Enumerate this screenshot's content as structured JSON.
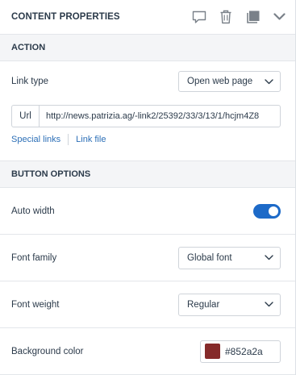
{
  "header": {
    "title": "CONTENT PROPERTIES",
    "icons": [
      "comment-icon",
      "trash-icon",
      "duplicate-icon",
      "chevron-down-icon"
    ]
  },
  "action": {
    "section_title": "ACTION",
    "link_type_label": "Link type",
    "link_type_value": "Open web page",
    "url_prefix": "Url",
    "url_value": "http://news.patrizia.ag/-link2/25392/33/3/13/1/hcjm4Z8",
    "links": [
      "Special links",
      "Link file"
    ]
  },
  "button_options": {
    "section_title": "BUTTON OPTIONS",
    "auto_width_label": "Auto width",
    "auto_width_on": true,
    "font_family_label": "Font family",
    "font_family_value": "Global font",
    "font_weight_label": "Font weight",
    "font_weight_value": "Regular",
    "background_color_label": "Background color",
    "background_color_value": "#852a2a"
  },
  "colors": {
    "accent": "#1d6ac8",
    "link": "#2c6fb7",
    "text": "#2b3a4a",
    "icon": "#7a8189",
    "section_bg": "#f4f5f7"
  }
}
